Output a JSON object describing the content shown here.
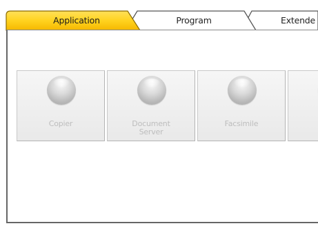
{
  "tabs": [
    {
      "label": "Application",
      "active": true
    },
    {
      "label": "Program",
      "active": false
    },
    {
      "label": "Extende",
      "active": false
    }
  ],
  "app_buttons": [
    {
      "label": "Copier",
      "label_line2": ""
    },
    {
      "label": "Document",
      "label_line2": "Server"
    },
    {
      "label": "Facsimile",
      "label_line2": ""
    },
    {
      "label": "",
      "label_line2": ""
    }
  ],
  "colors": {
    "active_tab_fill": "#ffd21f",
    "active_tab_edge": "#e7a500",
    "inactive_tab_fill": "#ffffff",
    "outline": "#555555",
    "disabled_text": "#bdbdbd"
  },
  "icons": {
    "app_button": "sphere-icon"
  }
}
